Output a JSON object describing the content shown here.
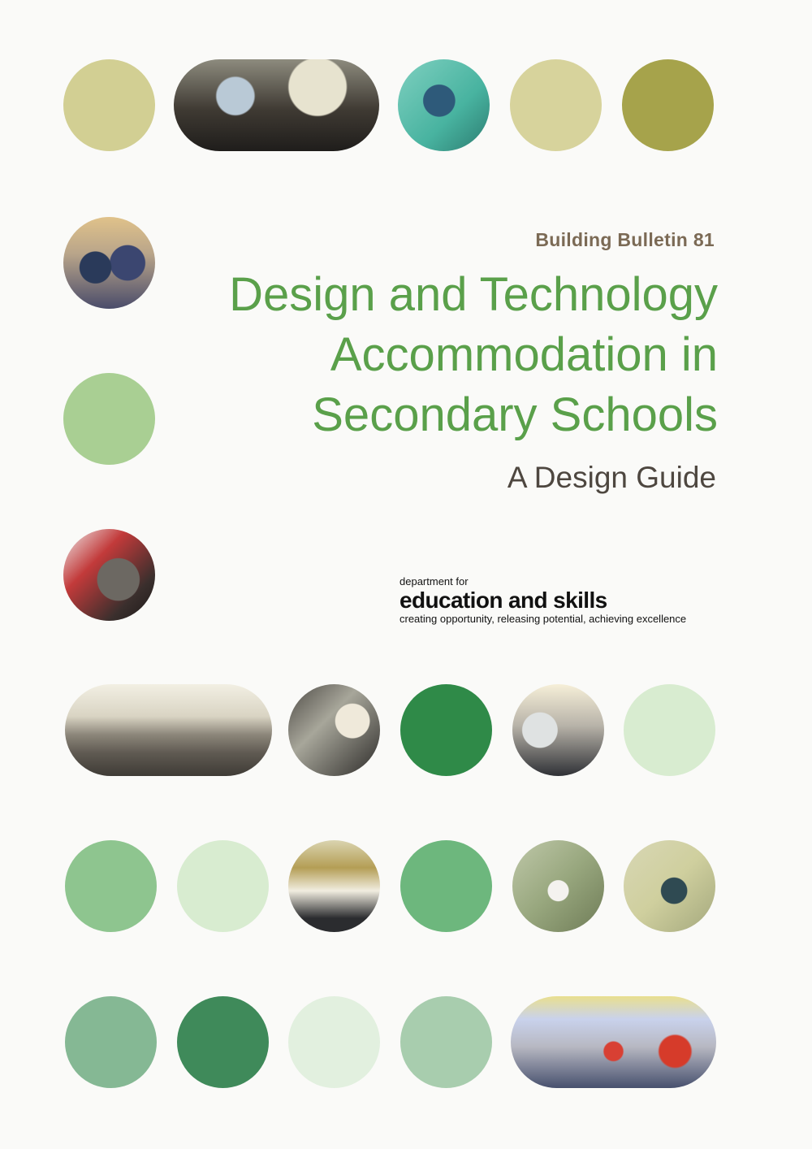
{
  "cover": {
    "series": "Building Bulletin 81",
    "title_lines": [
      "Design and Technology",
      "Accommodation in",
      "Secondary Schools"
    ],
    "subtitle": "A Design Guide"
  },
  "publisher": {
    "prefix": "department for",
    "name": "education and skills",
    "tagline": "creating opportunity, releasing potential, achieving excellence"
  },
  "palette": {
    "olive_light": "#d2cf93",
    "olive_dark": "#a6a34b",
    "green_light": "#a9cf93",
    "green_pale": "#d8ecd0",
    "green_mid": "#8ec58f",
    "green_dark": "#2f8a48",
    "green_deep": "#3f8a5a",
    "green_grey": "#94b99a",
    "title_green": "#5aa04a",
    "series_brown": "#7b6a55"
  }
}
